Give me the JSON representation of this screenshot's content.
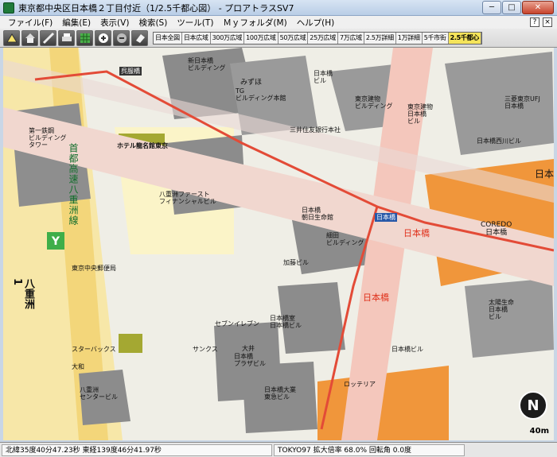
{
  "window": {
    "title": "東京都中央区日本橋２丁目付近（1/2.5千都心図） - プロアトラスSV7",
    "minimize": "─",
    "maximize": "□",
    "close": "✕"
  },
  "menu": [
    "ファイル(F)",
    "編集(E)",
    "表示(V)",
    "検索(S)",
    "ツール(T)",
    "Ｍｙフォルダ(M)",
    "ヘルプ(H)"
  ],
  "subwindow_controls": [
    "?",
    "×"
  ],
  "toolbar": {
    "tools": [
      "map-mode-icon",
      "home-icon",
      "measure-icon",
      "print-icon",
      "grid-icon",
      "zoom-in-icon",
      "zoom-out-icon",
      "eraser-icon"
    ],
    "scales": [
      "日本全図",
      "日本広域",
      "300万広域",
      "100万広域",
      "50万広域",
      "25万広域",
      "7万広域",
      "2.5万詳細",
      "1万詳細",
      "5千市街",
      "2.5千都心"
    ],
    "active_scale": "2.5千都心"
  },
  "map": {
    "labels": {
      "shintokiwabashi": "新日本橋\nビルディング",
      "mizuho": "みずほ",
      "tg": "TG\nビルディング本館",
      "nihonbashi_bldg": "日本橋\nビル",
      "tokyo_tatemono": "東京建物\nビルディング",
      "tokyo_tatemono2": "東京建物\n日本橋\nビル",
      "sanmitsu": "三菱東京UFJ\n日本橋",
      "mitsui_sumitomo": "三井住友銀行本社",
      "nihonbashi_nishikawa": "日本橋西川ビル",
      "tekko_bldg": "第一鉄鋼\nビルディング\nタワー",
      "hotel": "ホテル龍名館東京",
      "yaesu_first": "八重洲ファースト\nフィナンシャルビル",
      "coredo": "COREDO\n日本橋",
      "nihonbashi_big": "日本橋",
      "shutoko": "首都高速八重洲線",
      "takashimaya_rest": "日本橋",
      "nihonbashi_asahi": "日本橋\n朝日生命館",
      "nihonbashi_kaikan": "細田\nビルディング",
      "kato": "加藤ビル",
      "tokyo_chuo_yubin": "東京中央郵便局",
      "yaesu1": "八重洲\n1",
      "seven": "セブンイレブン",
      "nihonbashi_shoji": "日本橋室\n日本橋ビル",
      "nihonbashi_plaza": "日本橋\nプラザビル",
      "nihonbashi_kotobuki": "日本橋大業\n東急ビル",
      "tairyuu": "太陽生命\n日本橋\nビル",
      "yamamoto": "日本橋ビル",
      "yaesu_center": "八重洲\nセンタービル",
      "sakuratsukuda": "スターバックス",
      "daiwa": "大和",
      "sunkus": "サンクス",
      "taiko": "大井",
      "nihonbashi_street": "日本橋",
      "nihonbashi_st_label": "日本橋",
      "kyobashi_bridge": "呉服橋",
      "station_sign": "日本橋",
      "tokyu_hands": "ロッテリア"
    }
  },
  "status": {
    "lat": "北緯35度40分47.23秒 東経139度46分41.97秒",
    "datum": "TOKYO97 拡大倍率 68.0% 回転角 0.0度",
    "compass_letter": "N",
    "scale_text": "40m"
  }
}
